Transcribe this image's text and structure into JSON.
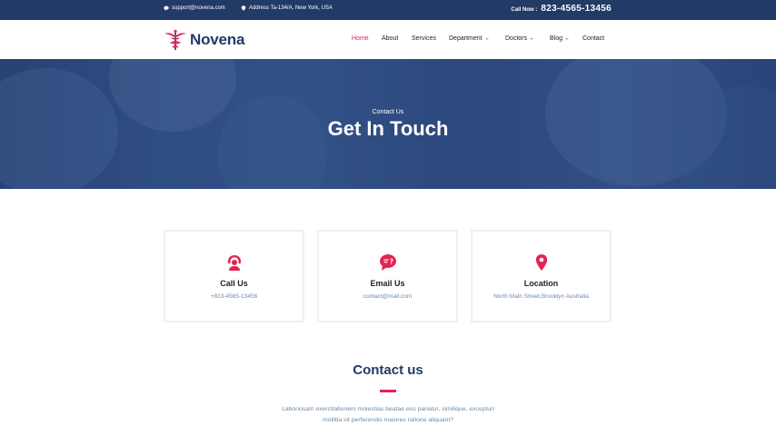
{
  "topbar": {
    "email": "support@novena.com",
    "address": "Address Ta-134/A, New York, USA",
    "call_label": "Call Now :",
    "call_number": "823-4565-13456"
  },
  "nav": {
    "brand": "Novena",
    "items": [
      {
        "label": "Home"
      },
      {
        "label": "About"
      },
      {
        "label": "Services"
      },
      {
        "label": "Department"
      },
      {
        "label": "Doctors"
      },
      {
        "label": "Blog"
      },
      {
        "label": "Contact"
      }
    ]
  },
  "hero": {
    "subtitle": "Contact Us",
    "title": "Get In Touch"
  },
  "cards": [
    {
      "title": "Call Us",
      "value": "+823-4565-13456",
      "icon": "headset-icon"
    },
    {
      "title": "Email Us",
      "value": "contact@mail.com",
      "icon": "chat-bubble-icon"
    },
    {
      "title": "Location",
      "value": "North Main Street,Brooklyn Australia",
      "icon": "map-pin-icon"
    }
  ],
  "contact_section": {
    "title": "Contact us",
    "description": "Laboriosam exercitationem molestias beatae eos pariatur, similique, excepturi mollitia sit perferendis maiores ratione aliquam?"
  },
  "colors": {
    "primary": "#223a66",
    "accent": "#e12454",
    "muted": "#6f8ba4"
  }
}
